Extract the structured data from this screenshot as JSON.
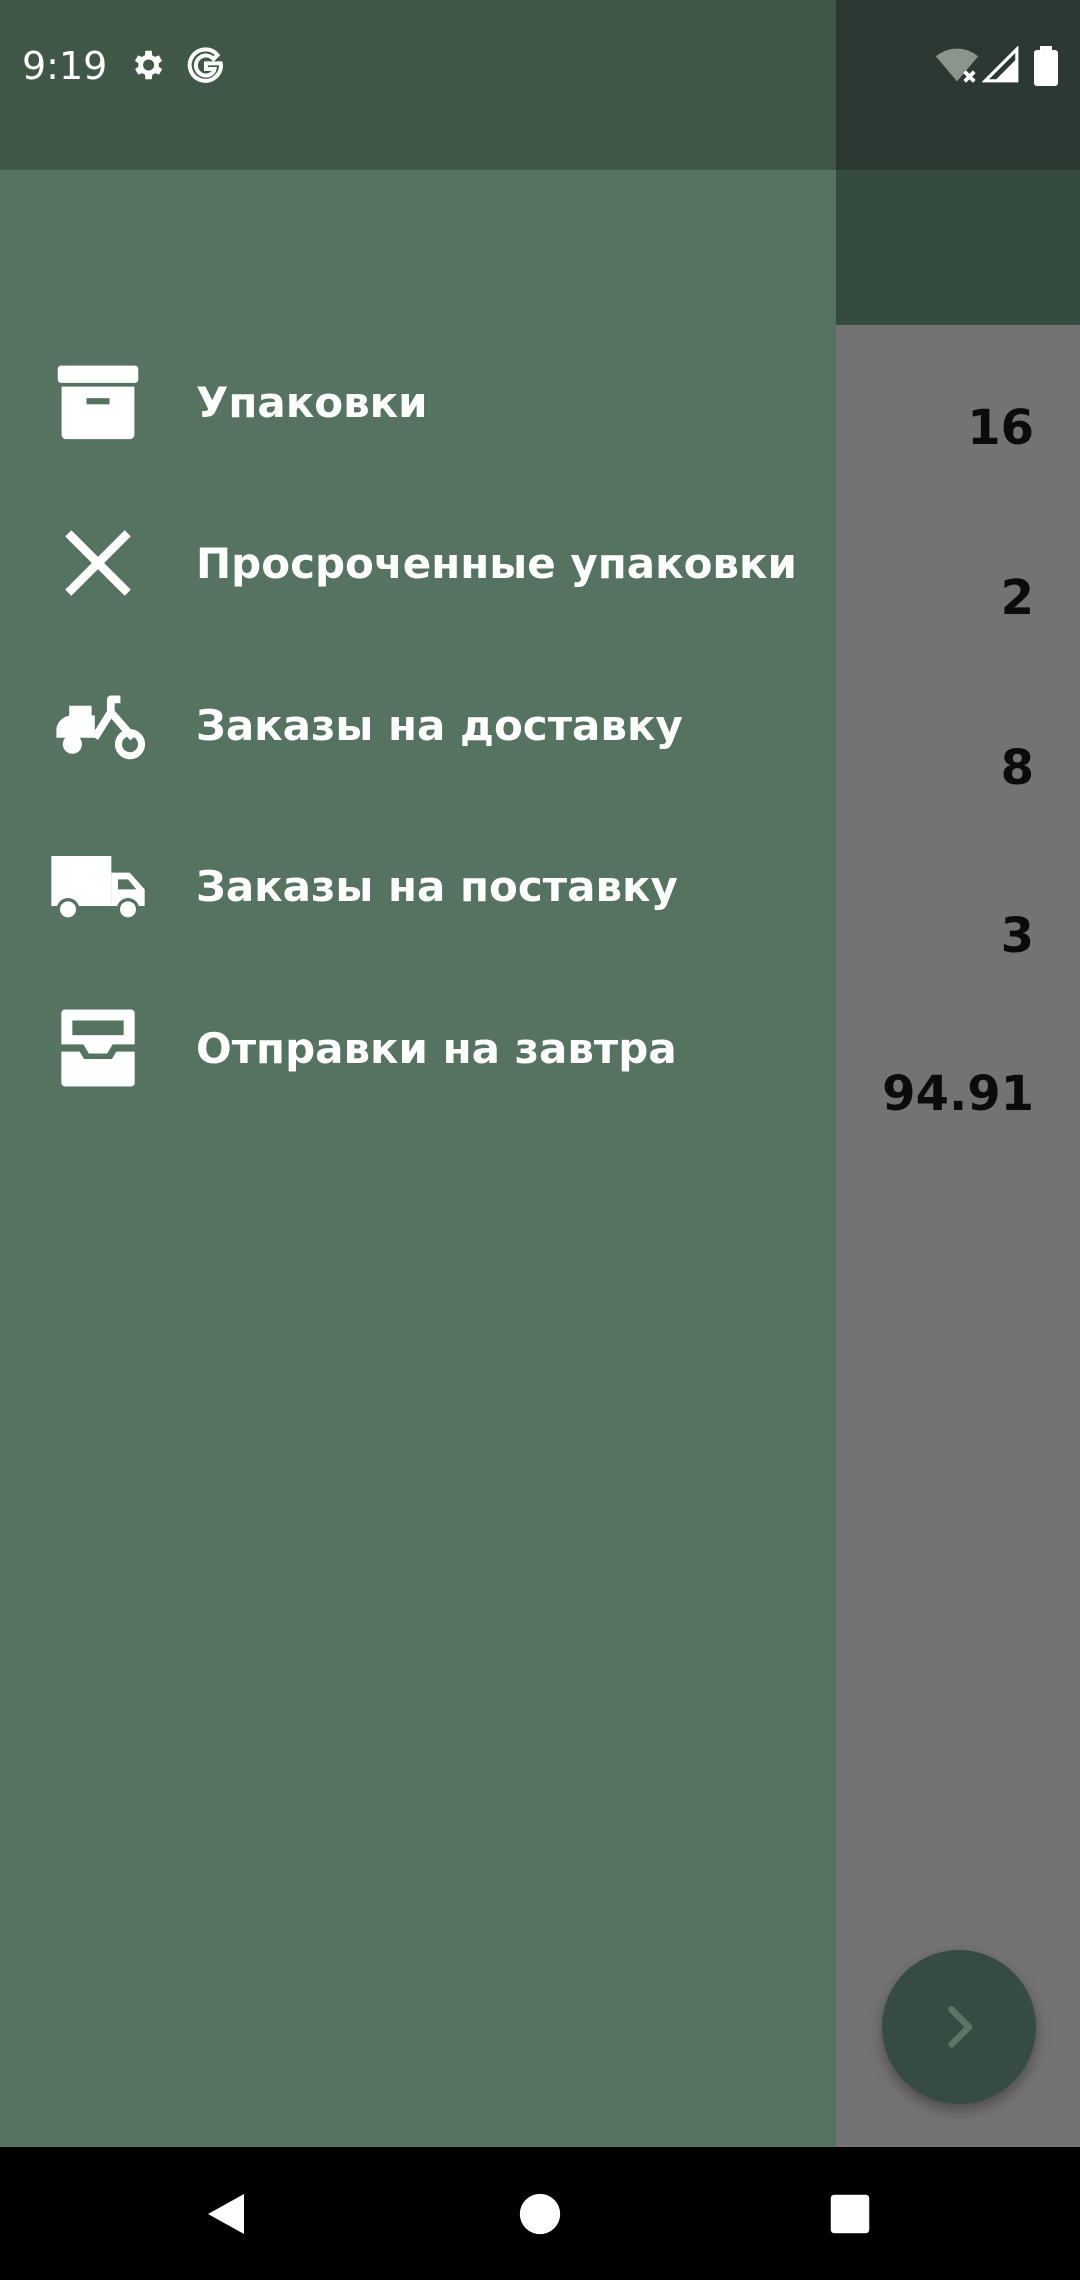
{
  "status_bar": {
    "time": "9:19",
    "icons": [
      "settings-icon",
      "google-icon",
      "wifi-off-icon",
      "signal-icon",
      "battery-icon"
    ]
  },
  "background": {
    "values": [
      "16",
      "2",
      "8",
      "3",
      "94.91"
    ]
  },
  "drawer": {
    "items": [
      {
        "label": "Упаковки",
        "icon": "archive-box-icon"
      },
      {
        "label": "Просроченные упаковки",
        "icon": "close-icon"
      },
      {
        "label": "Заказы на доставку",
        "icon": "scooter-icon"
      },
      {
        "label": "Заказы на поставку",
        "icon": "truck-icon"
      },
      {
        "label": "Отправки на завтра",
        "icon": "inbox-tray-icon"
      }
    ]
  },
  "fab": {
    "icon": "chevron-right-icon"
  },
  "nav_bar": {
    "icons": [
      "back-icon",
      "home-icon",
      "recents-icon"
    ]
  },
  "colors": {
    "drawer": "#557360",
    "drawer_status": "#405646",
    "accent_dark": "#354b40",
    "scrim": "#737373"
  }
}
